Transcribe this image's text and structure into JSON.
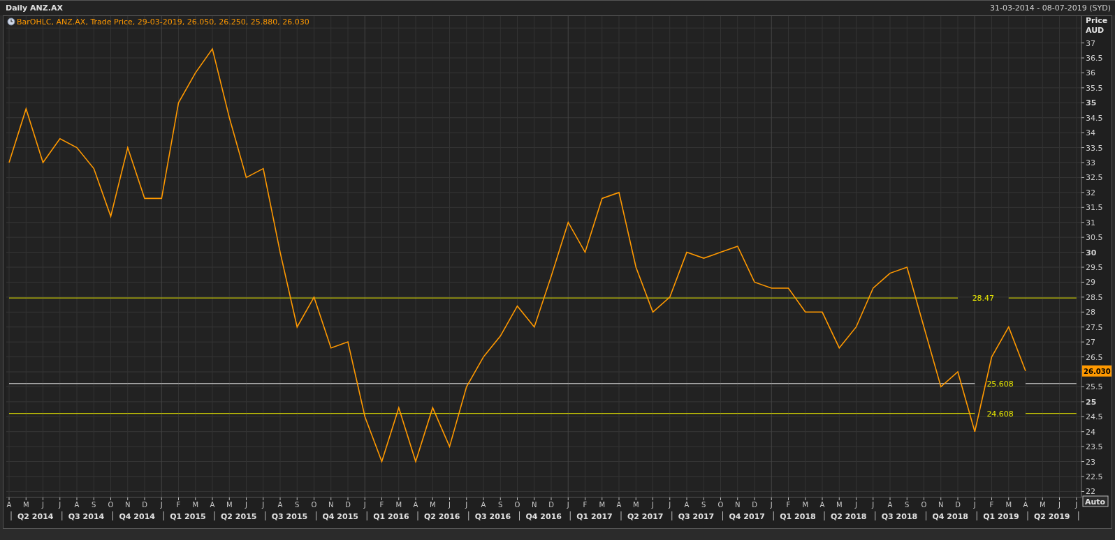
{
  "window": {
    "title": "Daily ANZ.AX",
    "date_range": "31-03-2014 - 08-07-2019 (SYD)"
  },
  "legend": {
    "text": "BarOHLC, ANZ.AX, Trade Price, 29-03-2019, 26.050, 26.250, 25.880, 26.030"
  },
  "axis_title": [
    "Price",
    "AUD"
  ],
  "last_price": "26.030",
  "auto_button": "Auto",
  "quarters": [
    "Q2 2014",
    "Q3 2014",
    "Q4 2014",
    "Q1 2015",
    "Q2 2015",
    "Q3 2015",
    "Q4 2015",
    "Q1 2016",
    "Q2 2016",
    "Q3 2016",
    "Q4 2016",
    "Q1 2017",
    "Q2 2017",
    "Q3 2017",
    "Q4 2017",
    "Q1 2018",
    "Q2 2018",
    "Q3 2018",
    "Q4 2018",
    "Q1 2019",
    "Q2 2019"
  ],
  "chart_data": {
    "type": "line",
    "categories": [
      "A",
      "M",
      "J",
      "J",
      "A",
      "S",
      "O",
      "N",
      "D",
      "J",
      "F",
      "M",
      "A",
      "M",
      "J",
      "J",
      "A",
      "S",
      "O",
      "N",
      "D",
      "J",
      "F",
      "M",
      "A",
      "M",
      "J",
      "J",
      "A",
      "S",
      "O",
      "N",
      "D",
      "J",
      "F",
      "M",
      "A",
      "M",
      "J",
      "J",
      "A",
      "S",
      "O",
      "N",
      "D",
      "J",
      "F",
      "M",
      "A",
      "M",
      "J",
      "J",
      "A",
      "S",
      "O",
      "N",
      "D",
      "J",
      "F",
      "M",
      "A",
      "M",
      "J",
      "J"
    ],
    "ylim": [
      21.8,
      37.9
    ],
    "grid": true,
    "yticks": [
      22,
      22.5,
      23,
      23.5,
      24,
      24.5,
      25,
      25.5,
      26.5,
      27,
      27.5,
      28,
      28.5,
      29,
      29.5,
      30,
      30.5,
      31,
      31.5,
      32,
      32.5,
      33,
      33.5,
      34,
      34.5,
      35,
      35.5,
      36,
      36.5,
      37
    ],
    "series": [
      {
        "color": "#ff9900",
        "values": [
          33.0,
          34.8,
          33.0,
          33.8,
          33.5,
          32.8,
          31.2,
          33.5,
          31.8,
          31.8,
          35.0,
          36.0,
          36.8,
          34.5,
          32.5,
          32.8,
          30.0,
          27.5,
          28.5,
          26.8,
          27.0,
          24.5,
          23.0,
          24.8,
          23.0,
          24.8,
          23.5,
          25.5,
          26.5,
          27.2,
          28.2,
          27.5,
          29.2,
          31.0,
          30.0,
          31.8,
          32.0,
          29.5,
          28.0,
          28.5,
          30.0,
          29.8,
          30.0,
          30.2,
          29.0,
          28.8,
          28.8,
          28.0,
          28.0,
          26.8,
          27.5,
          28.8,
          29.3,
          29.5,
          27.5,
          25.5,
          26.0,
          24.0,
          26.5,
          27.5,
          26.03,
          null,
          null,
          null
        ]
      },
      {
        "name": "28.47",
        "color": "#e8e800",
        "values": [
          28.47,
          28.47,
          28.47,
          28.47,
          28.47,
          28.47,
          28.47,
          28.47,
          28.47,
          28.47,
          28.47,
          28.47,
          28.47,
          28.47,
          28.47,
          28.47,
          28.47,
          28.47,
          28.47,
          28.47,
          28.47,
          28.47,
          28.47,
          28.47,
          28.47,
          28.47,
          28.47,
          28.47,
          28.47,
          28.47,
          28.47,
          28.47,
          28.47,
          28.47,
          28.47,
          28.47,
          28.47,
          28.47,
          28.47,
          28.47,
          28.47,
          28.47,
          28.47,
          28.47,
          28.47,
          28.47,
          28.47,
          28.47,
          28.47,
          28.47,
          28.47,
          28.47,
          28.47,
          28.47,
          28.47,
          28.47,
          28.47,
          null,
          null,
          28.47,
          28.47,
          28.47,
          28.47,
          28.47
        ]
      },
      {
        "name": "25.608",
        "color": "#e6e6e6",
        "values": [
          25.608,
          25.608,
          25.608,
          25.608,
          25.608,
          25.608,
          25.608,
          25.608,
          25.608,
          25.608,
          25.608,
          25.608,
          25.608,
          25.608,
          25.608,
          25.608,
          25.608,
          25.608,
          25.608,
          25.608,
          25.608,
          25.608,
          25.608,
          25.608,
          25.608,
          25.608,
          25.608,
          25.608,
          25.608,
          25.608,
          25.608,
          25.608,
          25.608,
          25.608,
          25.608,
          25.608,
          25.608,
          25.608,
          25.608,
          25.608,
          25.608,
          25.608,
          25.608,
          25.608,
          25.608,
          25.608,
          25.608,
          25.608,
          25.608,
          25.608,
          25.608,
          25.608,
          25.608,
          25.608,
          25.608,
          25.608,
          25.608,
          25.608,
          null,
          null,
          25.608,
          25.608,
          25.608,
          25.608
        ]
      },
      {
        "name": "24.608",
        "color": "#e8e800",
        "values": [
          24.608,
          24.608,
          24.608,
          24.608,
          24.608,
          24.608,
          24.608,
          24.608,
          24.608,
          24.608,
          24.608,
          24.608,
          24.608,
          24.608,
          24.608,
          24.608,
          24.608,
          24.608,
          24.608,
          24.608,
          24.608,
          24.608,
          24.608,
          24.608,
          24.608,
          24.608,
          24.608,
          24.608,
          24.608,
          24.608,
          24.608,
          24.608,
          24.608,
          24.608,
          24.608,
          24.608,
          24.608,
          24.608,
          24.608,
          24.608,
          24.608,
          24.608,
          24.608,
          24.608,
          24.608,
          24.608,
          24.608,
          24.608,
          24.608,
          24.608,
          24.608,
          24.608,
          24.608,
          24.608,
          24.608,
          24.608,
          24.608,
          24.608,
          null,
          null,
          24.608,
          24.608,
          24.608,
          24.608
        ]
      }
    ]
  }
}
